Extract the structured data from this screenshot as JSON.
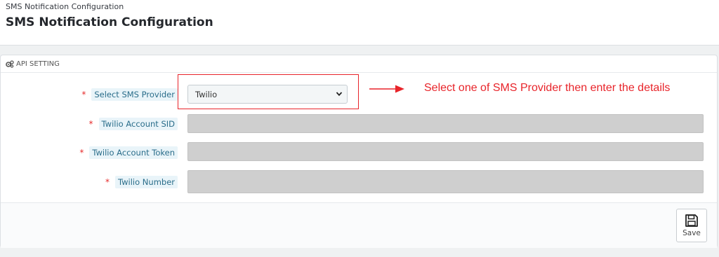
{
  "header": {
    "breadcrumb": "SMS Notification Configuration",
    "title": "SMS Notification Configuration"
  },
  "panel": {
    "heading": "API SETTING",
    "heading_icon": "gears-icon",
    "fields": [
      {
        "label": "Select SMS Provider",
        "required": "*",
        "type": "select",
        "value": "Twilio"
      },
      {
        "label": "Twilio Account SID",
        "required": "*",
        "type": "text",
        "value": ""
      },
      {
        "label": "Twilio Account Token",
        "required": "*",
        "type": "text",
        "value": ""
      },
      {
        "label": "Twilio Number",
        "required": "*",
        "type": "text",
        "value": ""
      }
    ],
    "annotation": "Select one of SMS Provider then enter the details",
    "save_label": "Save",
    "save_icon": "floppy-disk-icon"
  },
  "colors": {
    "required": "#e62b2b",
    "annotation": "#e8242a",
    "label_bg": "#e9f4f9",
    "label_text": "#2a6d8a"
  }
}
